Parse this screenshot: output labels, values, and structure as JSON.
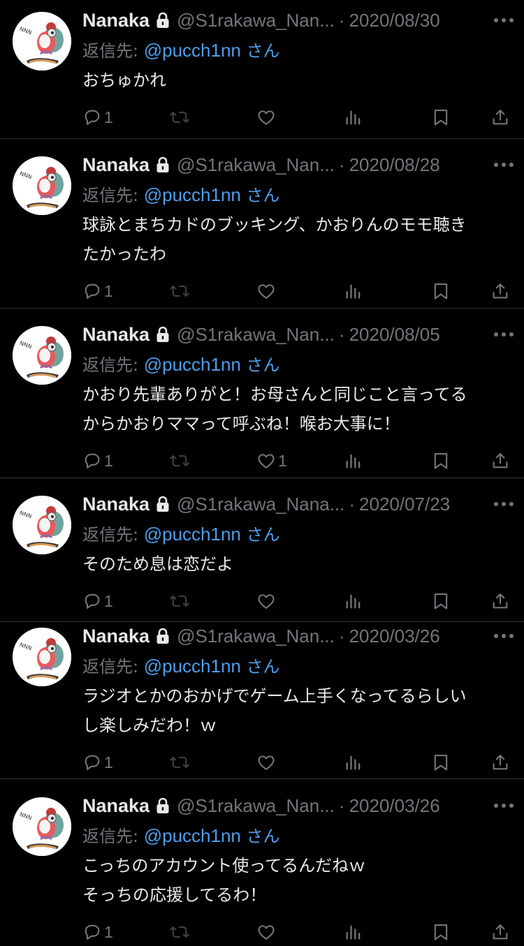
{
  "tweets": [
    {
      "name": "Nanaka",
      "handle": "@S1rakawa_Nan...",
      "date": "2020/08/30",
      "reply_prefix": "返信先:",
      "mention": "@pucch1nn",
      "mention_suffix": "さん",
      "text": "おちゅかれ",
      "replies": "1",
      "likes": ""
    },
    {
      "name": "Nanaka",
      "handle": "@S1rakawa_Nan...",
      "date": "2020/08/28",
      "reply_prefix": "返信先:",
      "mention": "@pucch1nn",
      "mention_suffix": "さん",
      "text": "球詠とまちカドのブッキング、かおりんのモモ聴き\nたかったわ",
      "replies": "1",
      "likes": ""
    },
    {
      "name": "Nanaka",
      "handle": "@S1rakawa_Nan...",
      "date": "2020/08/05",
      "reply_prefix": "返信先:",
      "mention": "@pucch1nn",
      "mention_suffix": "さん",
      "text": "かおり先輩ありがと！お母さんと同じこと言ってる\nからかおりママって呼ぶね！喉お大事に！",
      "replies": "1",
      "likes": "1"
    },
    {
      "name": "Nanaka",
      "handle": "@S1rakawa_Nana...",
      "date": "2020/07/23",
      "reply_prefix": "返信先:",
      "mention": "@pucch1nn",
      "mention_suffix": "さん",
      "text": "そのため息は恋だよ",
      "replies": "1",
      "likes": ""
    },
    {
      "name": "Nanaka",
      "handle": "@S1rakawa_Nan...",
      "date": "2020/03/26",
      "reply_prefix": "返信先:",
      "mention": "@pucch1nn",
      "mention_suffix": "さん",
      "text": "ラジオとかのおかげでゲーム上手くなってるらしい\nし楽しみだわ！ｗ",
      "replies": "1",
      "likes": ""
    },
    {
      "name": "Nanaka",
      "handle": "@S1rakawa_Nan...",
      "date": "2020/03/26",
      "reply_prefix": "返信先:",
      "mention": "@pucch1nn",
      "mention_suffix": "さん",
      "text": "こっちのアカウント使ってるんだねｗ\nそっちの応援してるわ！",
      "replies": "1",
      "likes": ""
    }
  ],
  "colors": {
    "background": "#000000",
    "text": "#e7e9ea",
    "muted": "#71767b",
    "link": "#4c9eeb",
    "divider": "#2f3336"
  },
  "icons": {
    "lock": "lock-icon",
    "more": "more-icon",
    "reply": "reply-icon",
    "retweet": "retweet-icon",
    "like": "like-icon",
    "views": "views-icon",
    "bookmark": "bookmark-icon",
    "share": "share-icon"
  }
}
